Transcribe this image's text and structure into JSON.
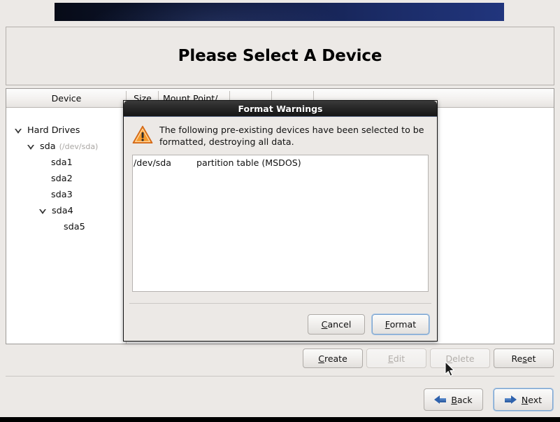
{
  "window": {
    "title_heading": "Please Select A Device"
  },
  "device_table": {
    "columns": [
      {
        "name": "device",
        "label": "Device"
      },
      {
        "name": "size",
        "label": "Size"
      },
      {
        "name": "mount_point",
        "label": "Mount Point/"
      },
      {
        "name": "col4",
        "label": ""
      },
      {
        "name": "col5",
        "label": ""
      },
      {
        "name": "col6",
        "label": ""
      }
    ],
    "tree": [
      {
        "label": "Hard Drives",
        "sub": "",
        "depth": 0,
        "expander": "expanded"
      },
      {
        "label": "sda",
        "sub": "(/dev/sda)",
        "depth": 1,
        "expander": "expanded"
      },
      {
        "label": "sda1",
        "sub": "",
        "depth": 2,
        "expander": "none"
      },
      {
        "label": "sda2",
        "sub": "",
        "depth": 2,
        "expander": "none"
      },
      {
        "label": "sda3",
        "sub": "",
        "depth": 2,
        "expander": "none"
      },
      {
        "label": "sda4",
        "sub": "",
        "depth": 2,
        "expander": "expanded"
      },
      {
        "label": "sda5",
        "sub": "",
        "depth": 3,
        "expander": "none"
      }
    ]
  },
  "action_buttons": [
    {
      "name": "create",
      "label": "Create",
      "mnemonic": "C",
      "before": "",
      "after": "reate",
      "enabled": true
    },
    {
      "name": "edit",
      "label": "Edit",
      "mnemonic": "E",
      "before": "",
      "after": "dit",
      "enabled": false
    },
    {
      "name": "delete",
      "label": "Delete",
      "mnemonic": "D",
      "before": "",
      "after": "elete",
      "enabled": false
    },
    {
      "name": "reset",
      "label": "Reset",
      "mnemonic": "s",
      "before": "Re",
      "after": "et",
      "enabled": true
    }
  ],
  "nav_buttons": [
    {
      "name": "back",
      "label": "Back",
      "mnemonic": "B",
      "before": "",
      "after": "ack",
      "icon": "arrow-left-icon",
      "focused": false
    },
    {
      "name": "next",
      "label": "Next",
      "mnemonic": "N",
      "before": "",
      "after": "ext",
      "icon": "arrow-right-icon",
      "focused": true
    }
  ],
  "dialog": {
    "title": "Format Warnings",
    "icon": "warning-triangle-icon",
    "message": "The following pre-existing devices have been selected to be formatted, destroying all data.",
    "list": [
      {
        "device": "/dev/sda",
        "description": "partition table (MSDOS)"
      }
    ],
    "buttons": [
      {
        "name": "cancel",
        "label": "Cancel",
        "mnemonic": "C",
        "before": "",
        "after": "ancel",
        "focused": false
      },
      {
        "name": "format",
        "label": "Format",
        "mnemonic": "F",
        "before": "",
        "after": "ormat",
        "focused": true
      }
    ]
  },
  "colors": {
    "banner_dark": "#070b17",
    "banner_blue": "#21357d",
    "panel_bg": "#ece9e6",
    "warning_orange": "#f0922b",
    "focus_blue": "#7ba4cf",
    "arrow_blue": "#2f62ad"
  }
}
